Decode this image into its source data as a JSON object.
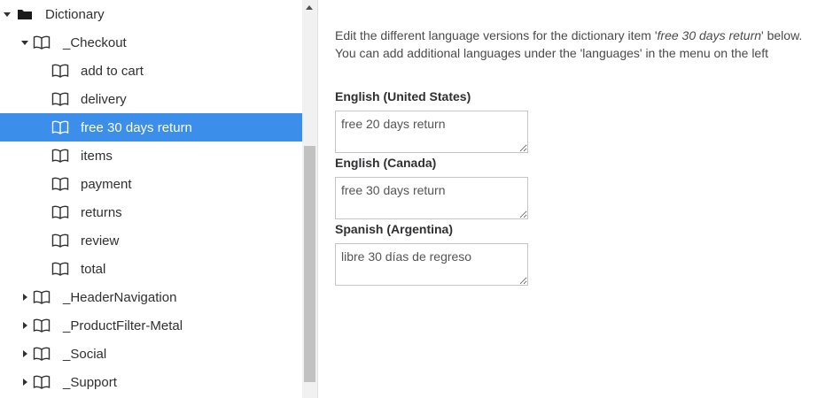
{
  "tree": {
    "root": {
      "label": "Dictionary",
      "icon": "folder-icon",
      "expanded": true
    },
    "checkout": {
      "label": "_Checkout",
      "icon": "book-icon",
      "expanded": true
    },
    "checkout_items": [
      {
        "label": "add to cart",
        "selected": false
      },
      {
        "label": "delivery",
        "selected": false
      },
      {
        "label": "free 30 days return",
        "selected": true
      },
      {
        "label": "items",
        "selected": false
      },
      {
        "label": "payment",
        "selected": false
      },
      {
        "label": "returns",
        "selected": false
      },
      {
        "label": "review",
        "selected": false
      },
      {
        "label": "total",
        "selected": false
      }
    ],
    "siblings": [
      {
        "label": "_HeaderNavigation",
        "expanded": false
      },
      {
        "label": "_ProductFilter-Metal",
        "expanded": false
      },
      {
        "label": "_Social",
        "expanded": false
      },
      {
        "label": "_Support",
        "expanded": false
      }
    ]
  },
  "editor": {
    "intro_line1_prefix": "Edit the different language versions for the dictionary item '",
    "intro_item": "free 30 days return",
    "intro_line1_suffix": "' below.",
    "intro_line2": "You can add additional languages under the 'languages' in the menu on the left",
    "fields": [
      {
        "label": "English (United States)",
        "value": "free 20 days return"
      },
      {
        "label": "English (Canada)",
        "value": "free 30 days return"
      },
      {
        "label": "Spanish (Argentina)",
        "value": "libre 30 días de regreso"
      }
    ]
  },
  "colors": {
    "selection": "#3b8ee9",
    "text": "#303033"
  }
}
